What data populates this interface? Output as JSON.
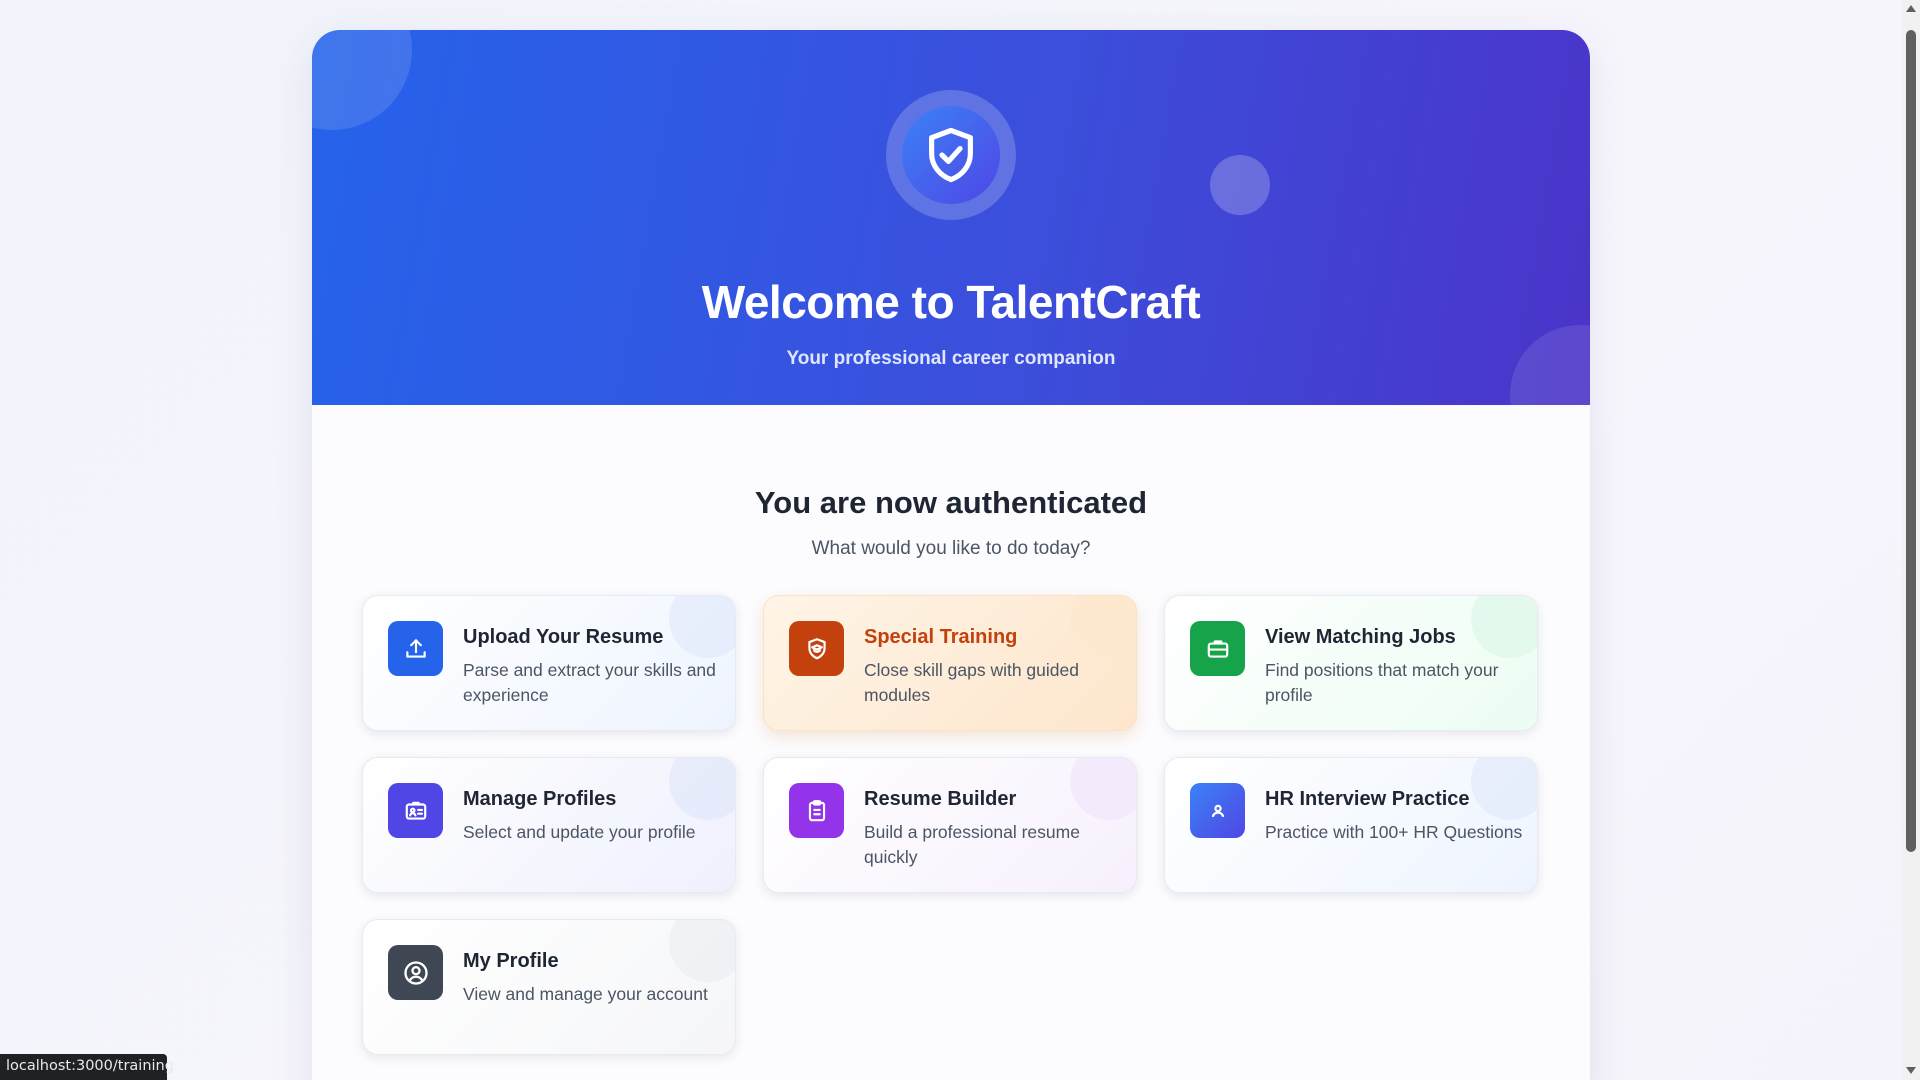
{
  "hero": {
    "title": "Welcome to TalentCraft",
    "subtitle": "Your professional career companion",
    "logo_icon": "shield-check-icon"
  },
  "main": {
    "title": "You are now authenticated",
    "subtitle": "What would you like to do today?"
  },
  "cards": [
    {
      "title": "Upload Your Resume",
      "desc": "Parse and extract your skills and experience",
      "icon": "upload-icon",
      "color": "#2563eb"
    },
    {
      "title": "Special Training",
      "desc": "Close skill gaps with guided modules",
      "icon": "graduation-shield-icon",
      "color": "#c2410c"
    },
    {
      "title": "View Matching Jobs",
      "desc": "Find positions that match your profile",
      "icon": "briefcase-icon",
      "color": "#16a34a"
    },
    {
      "title": "Manage Profiles",
      "desc": "Select and update your profile",
      "icon": "id-card-icon",
      "color": "#4f46e5"
    },
    {
      "title": "Resume Builder",
      "desc": "Build a professional resume quickly",
      "icon": "clipboard-icon",
      "color": "#9333ea"
    },
    {
      "title": "HR Interview Practice",
      "desc": "Practice with 100+ HR Questions",
      "icon": "user-icon",
      "color": "#4f5fe8"
    },
    {
      "title": "My Profile",
      "desc": "View and manage your account",
      "icon": "user-circle-icon",
      "color": "#374151"
    }
  ],
  "status_url": "localhost:3000/training"
}
